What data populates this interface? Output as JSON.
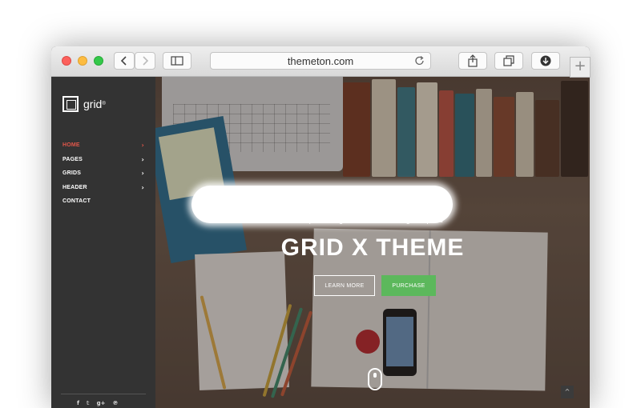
{
  "browser": {
    "url": "themeton.com",
    "new_tab_symbol": "+",
    "back_icon": "chevron-left-icon",
    "forward_icon": "chevron-right-icon",
    "sidebar_icon": "sidebar-icon",
    "share_icon": "share-icon",
    "tabs_icon": "tabs-overview-icon",
    "download_icon": "download-icon",
    "reload_icon": "reload-icon"
  },
  "site": {
    "logo_text": "grid",
    "logo_sup": "®",
    "nav": [
      {
        "label": "HOME",
        "arrow": "›",
        "active": true
      },
      {
        "label": "PAGES",
        "arrow": "›"
      },
      {
        "label": "GRIDS",
        "arrow": "›"
      },
      {
        "label": "HEADER",
        "arrow": "›"
      },
      {
        "label": "CONTACT",
        "arrow": ""
      }
    ],
    "social": [
      "f",
      "𝕥",
      "g+",
      "℗"
    ],
    "accent_color": "#e0564a",
    "hero": {
      "tagline": "Square Magazine Portfolio Blog Template",
      "title": "GRID X THEME",
      "learn_more": "LEARN MORE",
      "purchase": "PURCHASE",
      "purchase_color": "#5cb85c",
      "back_to_top": "^"
    }
  }
}
